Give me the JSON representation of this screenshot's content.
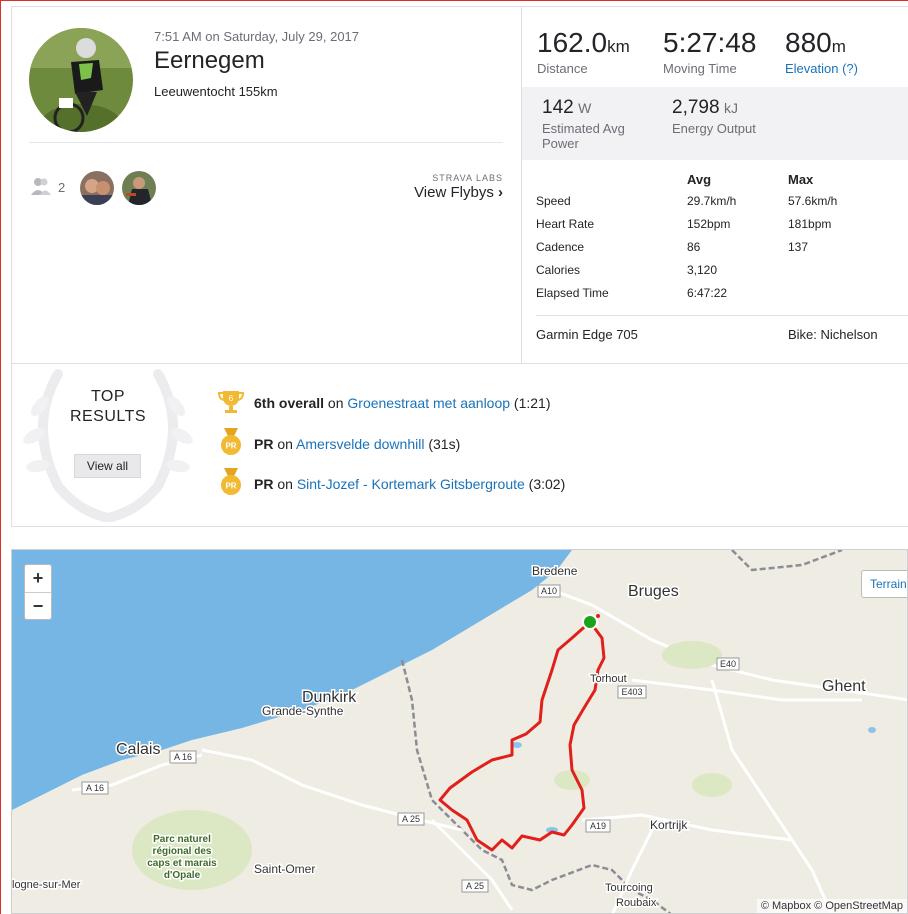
{
  "activity": {
    "datetime": "7:51 AM on Saturday, July 29, 2017",
    "title": "Eernegem",
    "description": "Leeuwentocht 155km",
    "group_count": "2"
  },
  "labs": {
    "caption": "STRAVA LABS",
    "link": "View Flybys"
  },
  "stats": {
    "distance": {
      "value": "162.0",
      "unit": "km",
      "label": "Distance"
    },
    "moving_time": {
      "value": "5:27:48",
      "label": "Moving Time"
    },
    "elevation": {
      "value": "880",
      "unit": "m",
      "label": "Elevation (?)"
    },
    "power": {
      "value": "142",
      "unit": "W",
      "label": "Estimated Avg Power"
    },
    "energy": {
      "value": "2,798",
      "unit": "kJ",
      "label": "Energy Output"
    }
  },
  "more_stats": {
    "headers": [
      "",
      "Avg",
      "Max"
    ],
    "rows": [
      [
        "Speed",
        "29.7km/h",
        "57.6km/h"
      ],
      [
        "Heart Rate",
        "152bpm",
        "181bpm"
      ],
      [
        "Cadence",
        "86",
        "137"
      ],
      [
        "Calories",
        "3,120",
        ""
      ],
      [
        "Elapsed Time",
        "6:47:22",
        ""
      ]
    ],
    "device": "Garmin Edge 705",
    "bike": "Bike: Nichelson"
  },
  "results": {
    "heading": "TOP RESULTS",
    "view_all": "View all",
    "items": [
      {
        "badge": "6",
        "strong": "6th overall",
        "on": " on ",
        "segment": "Groenestraat met aanloop",
        "time": " (1:21)"
      },
      {
        "badge": "PR",
        "strong": "PR",
        "on": " on ",
        "segment": "Amersvelde downhill",
        "time": " (31s)"
      },
      {
        "badge": "PR",
        "strong": "PR",
        "on": " on ",
        "segment": "Sint-Jozef - Kortemark Gitsbergroute",
        "time": " (3:02)"
      }
    ]
  },
  "map": {
    "zoom_in": "+",
    "zoom_out": "−",
    "terrain": "Terrain",
    "attribution": "© Mapbox © OpenStreetMap",
    "places": [
      "Bredene",
      "Bruges",
      "Torhout",
      "Ghent",
      "Dunkirk",
      "Grande-Synthe",
      "Calais",
      "Kortrijk",
      "Saint-Omer",
      "Parc naturel",
      "régional des",
      "caps et marais",
      "d'Opale",
      "logne-sur-Mer",
      "Tourcoing",
      "Roubaix"
    ],
    "roads": [
      "A10",
      "E40",
      "E403",
      "A 16",
      "A 16",
      "A 25",
      "A19",
      "A 25"
    ],
    "colors": {
      "sea": "#76b6e4",
      "land": "#efece4",
      "route": "#e0201a",
      "start": "#1ca31c"
    }
  }
}
